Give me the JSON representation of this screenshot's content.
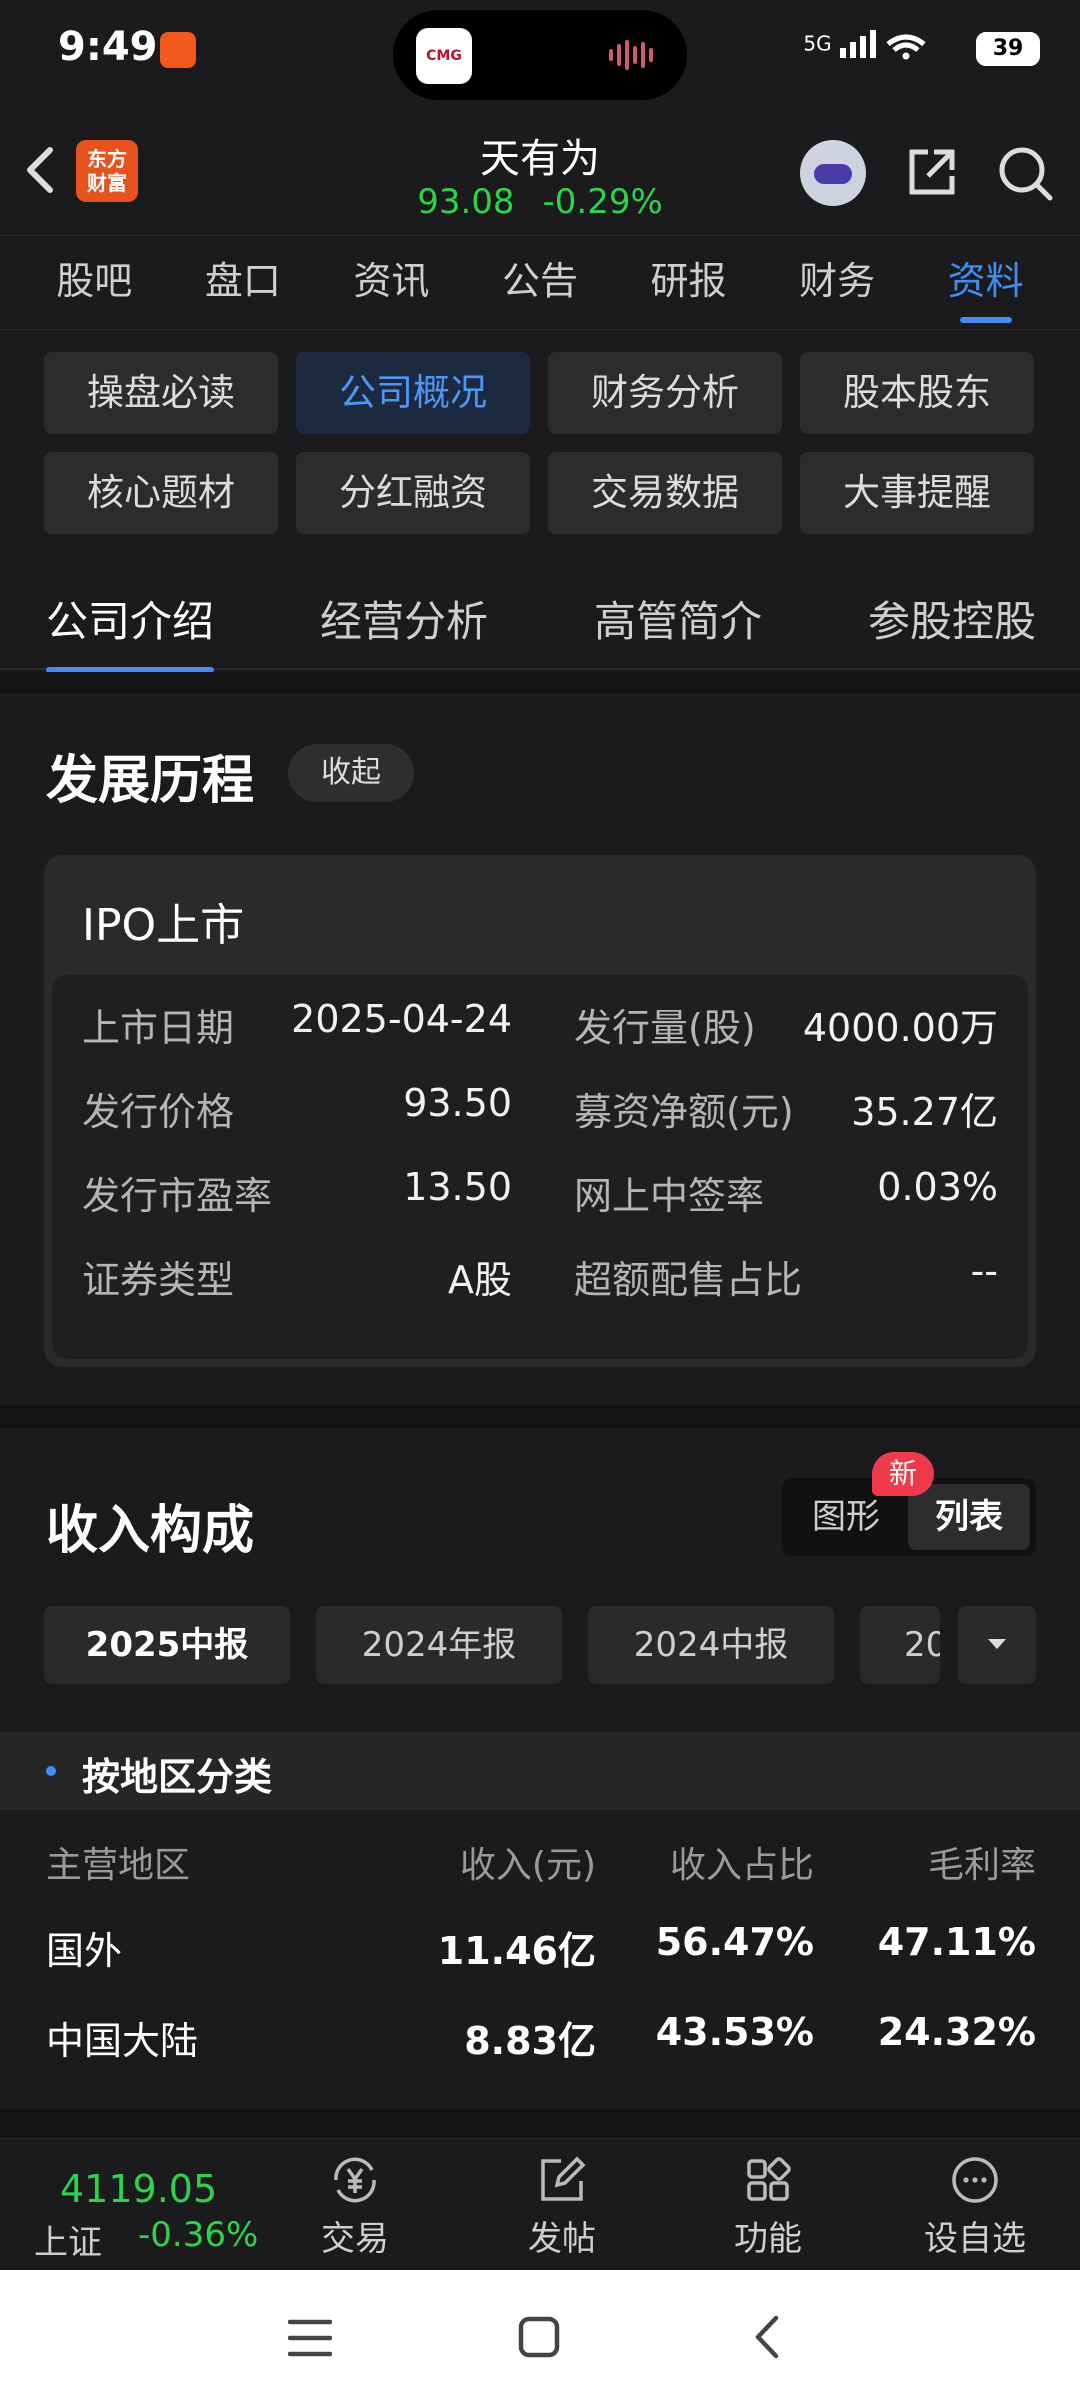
{
  "status": {
    "time": "9:49",
    "network": "5G",
    "battery": "39",
    "island_logo": "CMG"
  },
  "header": {
    "brand_logo_line1": "东方",
    "brand_logo_line2": "财富",
    "stock_name": "天有为",
    "price": "93.08",
    "change": "-0.29%"
  },
  "main_tabs": [
    "股吧",
    "盘口",
    "资讯",
    "公告",
    "研报",
    "财务",
    "资料"
  ],
  "categories": [
    "操盘必读",
    "公司概况",
    "财务分析",
    "股本股东",
    "核心题材",
    "分红融资",
    "交易数据",
    "大事提醒"
  ],
  "sub_tabs": [
    "公司介绍",
    "经营分析",
    "高管简介",
    "参股控股"
  ],
  "history": {
    "title": "发展历程",
    "collapse": "收起",
    "card_title": "IPO上市",
    "rows": [
      {
        "l1": "上市日期",
        "v1": "2025-04-24",
        "l2": "发行量(股)",
        "v2": "4000.00万"
      },
      {
        "l1": "发行价格",
        "v1": "93.50",
        "l2": "募资净额(元)",
        "v2": "35.27亿"
      },
      {
        "l1": "发行市盈率",
        "v1": "13.50",
        "l2": "网上中签率",
        "v2": "0.03%"
      },
      {
        "l1": "证券类型",
        "v1": "A股",
        "l2": "超额配售占比",
        "v2": "--"
      }
    ]
  },
  "income": {
    "title": "收入构成",
    "toggle": {
      "graph": "图形",
      "list": "列表",
      "badge": "新"
    },
    "periods": [
      "2025中报",
      "2024年报",
      "2024中报",
      "20"
    ],
    "group_title": "按地区分类",
    "headers": [
      "主营地区",
      "收入(元)",
      "收入占比",
      "毛利率"
    ],
    "rows": [
      [
        "国外",
        "11.46亿",
        "56.47%",
        "47.11%"
      ],
      [
        "中国大陆",
        "8.83亿",
        "43.53%",
        "24.32%"
      ]
    ]
  },
  "bottom": {
    "index_value": "4119.05",
    "index_name": "上证",
    "index_change": "-0.36%",
    "nav": [
      "交易",
      "发帖",
      "功能",
      "设自选"
    ]
  }
}
